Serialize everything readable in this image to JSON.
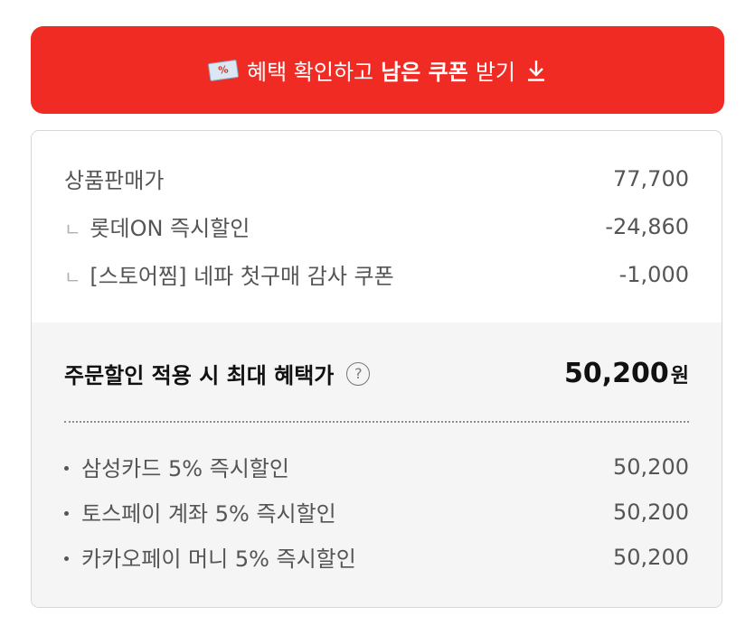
{
  "coupon_button": {
    "text_normal": "혜택 확인하고",
    "text_bold": "남은 쿠폰",
    "text_tail": "받기",
    "ticket_glyph": "%"
  },
  "price_rows": [
    {
      "label": "상품판매가",
      "value": "77,700"
    },
    {
      "label": "롯데ON 즉시할인",
      "value": "-24,860"
    },
    {
      "label": "[스토어찜] 네파 첫구매 감사 쿠폰",
      "value": "-1,000"
    }
  ],
  "sub_mark": "ㄴ",
  "max_benefit": {
    "label": "주문할인 적용 시 최대 혜택가",
    "help_glyph": "?",
    "value": "50,200",
    "unit": "원"
  },
  "card_discounts": [
    {
      "label": "삼성카드 5% 즉시할인",
      "value": "50,200"
    },
    {
      "label": "토스페이 계좌 5% 즉시할인",
      "value": "50,200"
    },
    {
      "label": "카카오페이 머니 5% 즉시할인",
      "value": "50,200"
    }
  ],
  "colors": {
    "accent": "#ef2b23",
    "panel_bg": "#f5f5f5",
    "border": "#d6d6d6"
  }
}
